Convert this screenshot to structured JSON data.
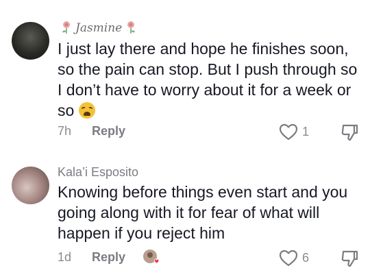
{
  "comments": [
    {
      "username": "Jasmine",
      "text": "I just lay there and hope he finishes soon, so the pain can stop. But I push through so I don’t have to worry about it for a week or so",
      "time": "7h",
      "reply_label": "Reply",
      "like_count": "1",
      "emoji": "weary-face"
    },
    {
      "username": "Kala’i Esposito",
      "text": "Knowing before things even start and you going along with it for fear of what will happen if you reject him",
      "time": "1d",
      "reply_label": "Reply",
      "like_count": "6"
    }
  ]
}
